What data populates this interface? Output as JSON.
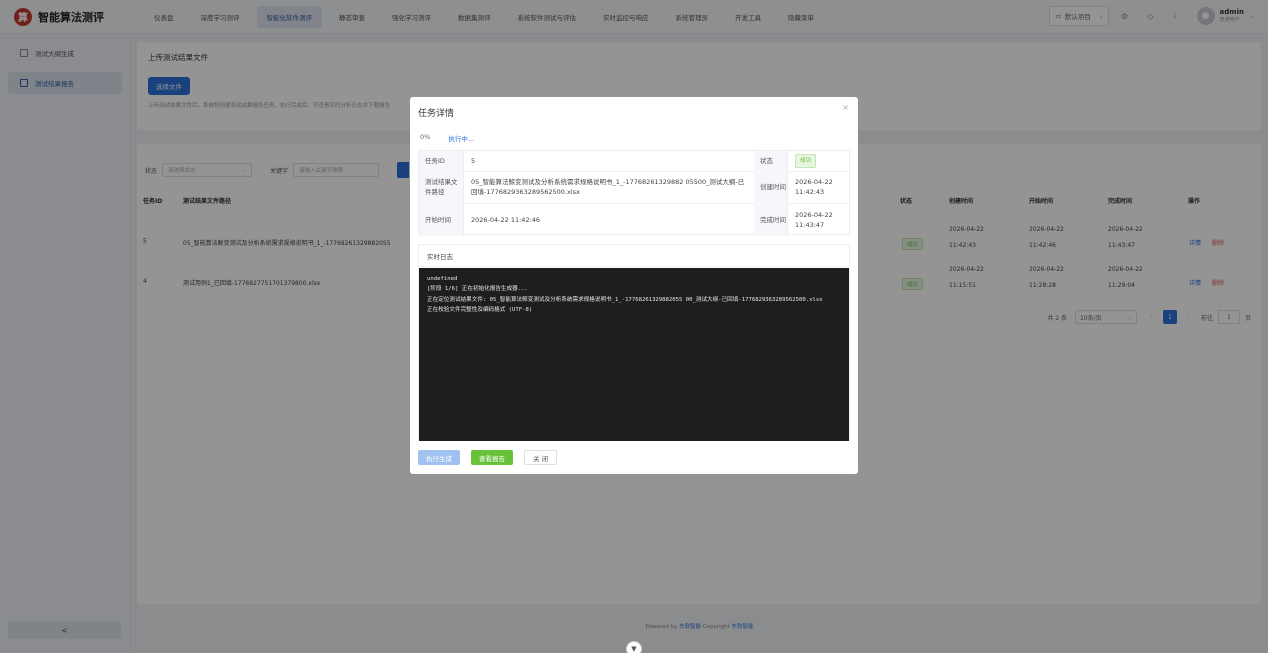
{
  "app": {
    "logo_char": "算",
    "title": "智能算法测评"
  },
  "topnav": {
    "items": [
      {
        "label": "仪表盘"
      },
      {
        "label": "深度学习测评"
      },
      {
        "label": "智能化软件测评"
      },
      {
        "label": "静态审查"
      },
      {
        "label": "强化学习测评"
      },
      {
        "label": "数据集测评"
      },
      {
        "label": "系统软件测试与评估"
      },
      {
        "label": "实时监控与响应"
      },
      {
        "label": "系统管理员"
      },
      {
        "label": "开发工具"
      },
      {
        "label": "隐藏菜单"
      }
    ],
    "active_index": 2,
    "project_select": "默认项目",
    "user": {
      "name": "admin",
      "role": "普通用户"
    }
  },
  "sidebar": {
    "items": [
      {
        "label": "测试大纲生成"
      },
      {
        "label": "测试结果报告"
      }
    ],
    "active_index": 1,
    "collapse_label": "<"
  },
  "upload": {
    "title": "上传测试结果文件",
    "select_button": "选择文件",
    "hint": "上传测试结果文件后，系统将创建测试结果报告任务，执行完成后，可查看实时分析日志并下载报告"
  },
  "filters": {
    "status_label": "状态",
    "status_placeholder": "请选择状态",
    "keyword_label": "关键字",
    "keyword_placeholder": "请输入关键字搜索"
  },
  "table": {
    "headers": {
      "id": "任务ID",
      "path": "测试结果文件路径",
      "status": "状态",
      "created": "创建时间",
      "started": "开始时间",
      "finished": "完成时间",
      "actions": "操作"
    },
    "rows": [
      {
        "id": "5",
        "path": "05_智能算法鲸变测试及分析系统需求规格说明书_1_-17768261329882055",
        "status": "成功",
        "created_date": "2026-04-22",
        "created_time": "11:42:43",
        "started_date": "2026-04-22",
        "started_time": "11:42:46",
        "finished_date": "2026-04-22",
        "finished_time": "11:43:47",
        "detail": "详情",
        "delete": "删除"
      },
      {
        "id": "4",
        "path": "测试用例1_已回填-1776827751701379800.xlsx",
        "status": "成功",
        "created_date": "2026-04-22",
        "created_time": "11:15:51",
        "started_date": "2026-04-22",
        "started_time": "11:28:28",
        "finished_date": "2026-04-22",
        "finished_time": "11:29:04",
        "detail": "详情",
        "delete": "删除"
      }
    ],
    "pager": {
      "total": "共 2 条",
      "page_size": "10条/页",
      "current_page": "1",
      "goto_label": "前往",
      "goto_value": "1",
      "page_suffix": "页"
    }
  },
  "footer": {
    "powered_by": "Powered by",
    "brand1": "东软智能",
    "copyright": "Copyright",
    "brand2": "东软智能"
  },
  "modal": {
    "title": "任务详情",
    "close_icon": "×",
    "progress": "0%",
    "progress_status": "执行中...",
    "fields": {
      "task_id_label": "任务ID",
      "task_id": "5",
      "status_label": "状态",
      "status": "成功",
      "path_label": "测试结果文件路径",
      "path": "05_智能算法鲸变测试及分析系统需求规格说明书_1_-17768261329882 05500_测试大纲-已回填-1776829363289562500.xlsx",
      "created_label": "创建时间",
      "created_date": "2026-04-22",
      "created_time": "11:42:43",
      "started_label": "开始时间",
      "started": "2026-04-22 11:42:46",
      "finished_label": "完成时间",
      "finished_date": "2026-04-22",
      "finished_time": "11:43:47"
    },
    "log_title": "实时日志",
    "log_lines": [
      "undefined",
      "[阶段 1/6] 正在初始化报告生成器...",
      "正在定位测试结果文件: 05_智能算法鲸变测试及分析系统需求规格说明书_1_-17768261329882055 00_测试大纲-已回填-1776829363289562500.xlsx",
      "正在校验文件完整性及编码格式 (UTF-8)"
    ],
    "buttons": {
      "run": "执行生成",
      "view": "查看报告",
      "close": "关 闭"
    }
  },
  "colors": {
    "primary": "#2e6fd8",
    "success": "#67c23a",
    "danger": "#e05555",
    "log_bg": "#1e1e1e"
  }
}
